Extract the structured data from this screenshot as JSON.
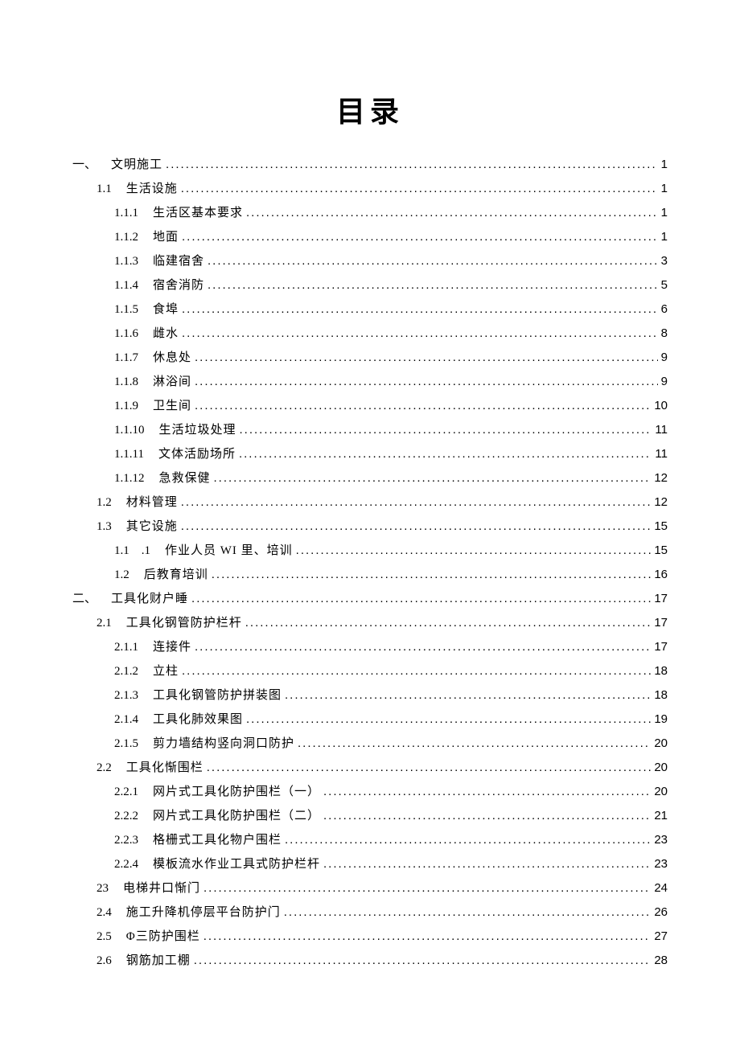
{
  "title": "目录",
  "entries": [
    {
      "indent": 0,
      "num": "一、",
      "label": "文明施工",
      "page": "1",
      "labelClass": "songti"
    },
    {
      "indent": 1,
      "num": "1.1",
      "label": "生活设施",
      "page": "1"
    },
    {
      "indent": 2,
      "num": "1.1.1",
      "label": "生活区基本要求",
      "page": "1"
    },
    {
      "indent": 2,
      "num": "1.1.2",
      "label": "地面",
      "page": "1"
    },
    {
      "indent": 2,
      "num": "1.1.3",
      "label": "临建宿舍",
      "page": "3"
    },
    {
      "indent": 2,
      "num": "1.1.4",
      "label": "宿舍消防",
      "page": "5"
    },
    {
      "indent": 2,
      "num": "1.1.5",
      "label": "食埠",
      "page": "6"
    },
    {
      "indent": 2,
      "num": "1.1.6",
      "label": "雌水",
      "page": "8"
    },
    {
      "indent": 2,
      "num": "1.1.7",
      "label": "休息处",
      "page": "9"
    },
    {
      "indent": 2,
      "num": "1.1.8",
      "label": "淋浴间",
      "page": "9"
    },
    {
      "indent": 2,
      "num": "1.1.9",
      "label": "卫生间",
      "page": "10"
    },
    {
      "indent": 2,
      "num": "1.1.10",
      "label": "生活垃圾处理",
      "page": "11"
    },
    {
      "indent": 2,
      "num": "1.1.11",
      "label": "文体活励场所",
      "page": "11"
    },
    {
      "indent": 2,
      "num": "1.1.12",
      "label": "急救保健",
      "page": "12"
    },
    {
      "indent": 1,
      "num": "1.2",
      "label": "材料管理",
      "page": "12"
    },
    {
      "indent": 1,
      "num": "1.3",
      "label": "其它设施",
      "page": "15"
    },
    {
      "indent": 2,
      "num": "1.1　.1",
      "label": "作业人员 WI 里、培训",
      "page": "15",
      "labelClass": "songti"
    },
    {
      "indent": 2,
      "num": "1.2",
      "label": "后教育培训",
      "page": "16",
      "labelClass": "songti"
    },
    {
      "indent": 0,
      "num": "二、",
      "label": "工具化财户睡",
      "page": "17",
      "labelClass": "songti"
    },
    {
      "indent": 1,
      "num": "2.1",
      "label": "工具化钢管防护栏杆",
      "page": "17"
    },
    {
      "indent": 2,
      "num": "2.1.1",
      "label": "连接件",
      "page": "17"
    },
    {
      "indent": 2,
      "num": "2.1.2",
      "label": "立柱",
      "page": "18"
    },
    {
      "indent": 2,
      "num": "2.1.3",
      "label": "工具化钢管防护拼装图",
      "page": "18"
    },
    {
      "indent": 2,
      "num": "2.1.4",
      "label": "工具化肺效果图",
      "page": "19"
    },
    {
      "indent": 2,
      "num": "2.1.5",
      "label": "剪力墙结构竖向洞口防护",
      "page": "20"
    },
    {
      "indent": 1,
      "num": "2.2",
      "label": "工具化惭围栏",
      "page": "20"
    },
    {
      "indent": 2,
      "num": "2.2.1",
      "label": "网片式工具化防护围栏（一）",
      "page": "20"
    },
    {
      "indent": 2,
      "num": "2.2.2",
      "label": "网片式工具化防护围栏（二）",
      "page": "21"
    },
    {
      "indent": 2,
      "num": "2.2.3",
      "label": "格栅式工具化物户围栏",
      "page": "23"
    },
    {
      "indent": 2,
      "num": "2.2.4",
      "label": "模板流水作业工具式防护栏杆",
      "page": "23"
    },
    {
      "indent": 1,
      "num": "23",
      "label": "电梯井口惭门",
      "page": "24"
    },
    {
      "indent": 1,
      "num": "2.4",
      "label": "施工升降机停层平台防护门",
      "page": "26"
    },
    {
      "indent": 1,
      "num": "2.5",
      "label": "Φ三防护围栏",
      "page": "27"
    },
    {
      "indent": 1,
      "num": "2.6",
      "label": "钢筋加工棚",
      "page": "28"
    }
  ]
}
